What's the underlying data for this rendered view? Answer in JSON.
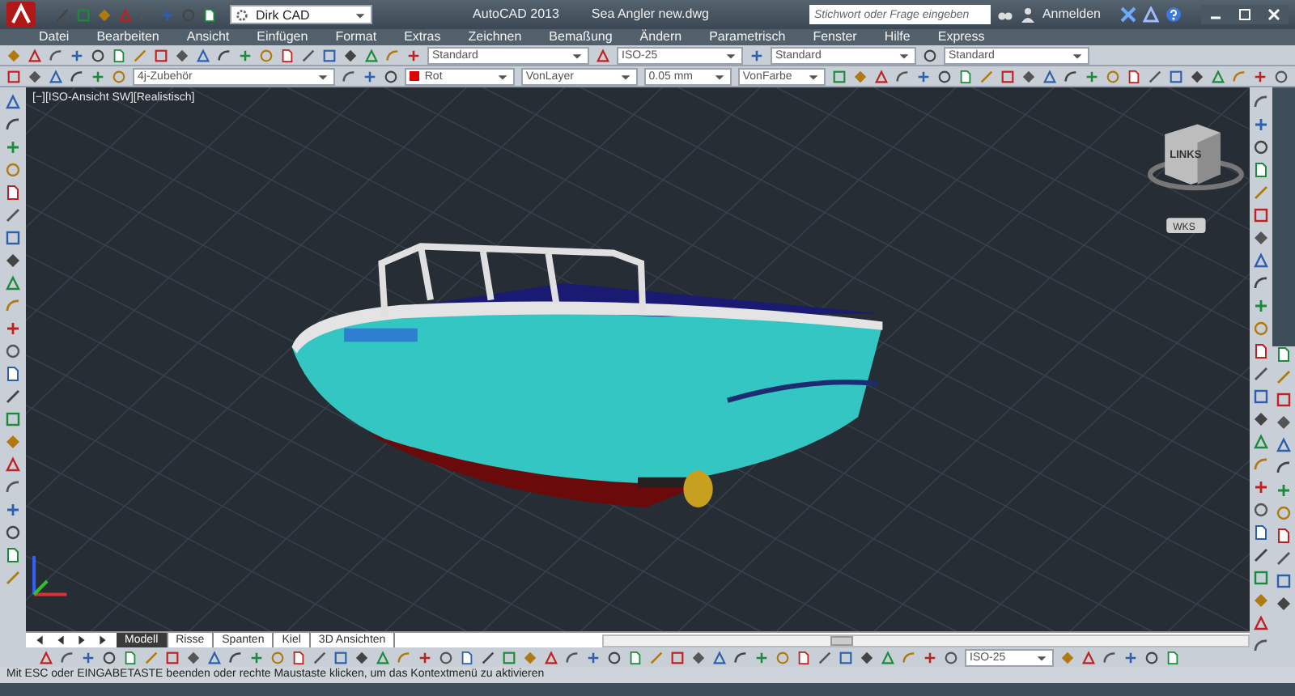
{
  "title_bar": {
    "workspace": "Dirk CAD",
    "app_title": "AutoCAD 2013",
    "file_name": "Sea Angler new.dwg",
    "search": {
      "placeholder": "Stichwort oder Frage eingeben"
    },
    "sign_in": "Anmelden"
  },
  "menu": [
    "Datei",
    "Bearbeiten",
    "Ansicht",
    "Einfügen",
    "Format",
    "Extras",
    "Zeichnen",
    "Bemaßung",
    "Ändern",
    "Parametrisch",
    "Fenster",
    "Hilfe",
    "Express"
  ],
  "toolbar_1": {
    "text_style": "Standard",
    "dim_style": "ISO-25",
    "table_style": "Standard",
    "multileader_style": "Standard"
  },
  "toolbar_2": {
    "layer": "4j-Zubehör",
    "color_name": "Rot",
    "linetype": "VonLayer",
    "lineweight": "0.05 mm",
    "plot_style": "VonFarbe"
  },
  "viewport": {
    "label": "[−][ISO-Ansicht SW][Realistisch]",
    "viewcube_face": "LINKS",
    "ucs_menu": "WKS"
  },
  "layout_tabs": [
    {
      "label": "Modell",
      "selected": true
    },
    {
      "label": "Risse",
      "selected": false
    },
    {
      "label": "Spanten",
      "selected": false
    },
    {
      "label": "Kiel",
      "selected": false
    },
    {
      "label": "3D Ansichten",
      "selected": false
    }
  ],
  "bottom_toolbar": {
    "dim_style": "ISO-25"
  },
  "status_bar": {
    "prompt": "Mit ESC oder EINGABETASTE beenden oder rechte Maustaste klicken, um das Kontextmenü zu aktivieren"
  }
}
